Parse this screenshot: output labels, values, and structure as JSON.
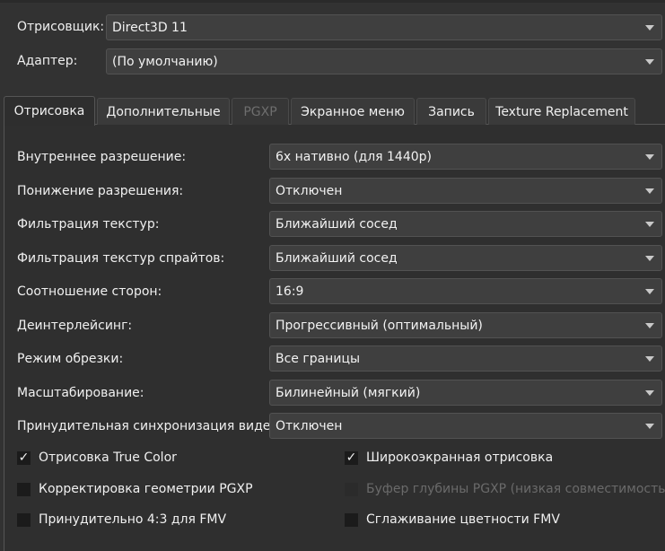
{
  "top": {
    "renderer_label": "Отрисовщик:",
    "renderer_value": "Direct3D 11",
    "adapter_label": "Адаптер:",
    "adapter_value": "(По умолчанию)"
  },
  "tabs": [
    {
      "label": "Отрисовка",
      "active": true,
      "disabled": false
    },
    {
      "label": "Дополнительные",
      "active": false,
      "disabled": false
    },
    {
      "label": "PGXP",
      "active": false,
      "disabled": true
    },
    {
      "label": "Экранное меню",
      "active": false,
      "disabled": false
    },
    {
      "label": "Запись",
      "active": false,
      "disabled": false
    },
    {
      "label": "Texture Replacement",
      "active": false,
      "disabled": false
    }
  ],
  "settings": [
    {
      "label": "Внутреннее разрешение:",
      "value": "6x нативно (для 1440p)"
    },
    {
      "label": "Понижение разрешения:",
      "value": "Отключен"
    },
    {
      "label": "Фильтрация текстур:",
      "value": "Ближайший сосед"
    },
    {
      "label": "Фильтрация текстур спрайтов:",
      "value": "Ближайший сосед"
    },
    {
      "label": "Соотношение сторон:",
      "value": "16:9"
    },
    {
      "label": "Деинтерлейсинг:",
      "value": "Прогрессивный (оптимальный)"
    },
    {
      "label": "Режим обрезки:",
      "value": "Все границы"
    },
    {
      "label": "Масштабирование:",
      "value": "Билинейный (мягкий)"
    },
    {
      "label": "Принудительная синхронизация видео:",
      "value": "Отключен"
    }
  ],
  "checkboxes": [
    {
      "label": "Отрисовка True Color",
      "checked": true,
      "disabled": false
    },
    {
      "label": "Широкоэкранная отрисовка",
      "checked": true,
      "disabled": false
    },
    {
      "label": "Корректировка геометрии PGXP",
      "checked": false,
      "disabled": false
    },
    {
      "label": "Буфер глубины PGXP (низкая совместимость)",
      "checked": false,
      "disabled": true
    },
    {
      "label": "Принудительно 4:3 для FMV",
      "checked": false,
      "disabled": false
    },
    {
      "label": "Сглаживание цветности FMV",
      "checked": false,
      "disabled": false
    }
  ]
}
